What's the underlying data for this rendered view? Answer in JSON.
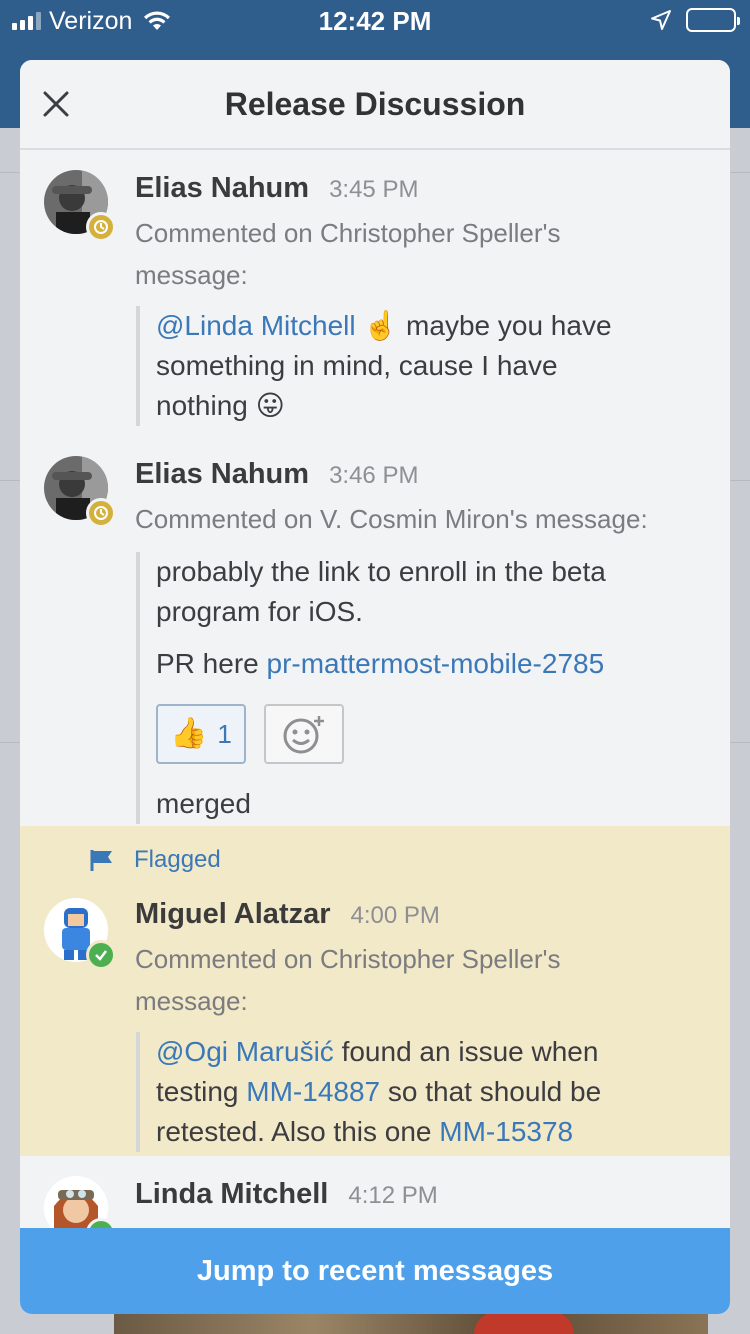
{
  "status_bar": {
    "carrier": "Verizon",
    "time": "12:42 PM"
  },
  "modal": {
    "title": "Release Discussion",
    "jump_label": "Jump to recent messages"
  },
  "posts": [
    {
      "author": "Elias Nahum",
      "time": "3:45 PM",
      "commented_line1": "Commented on Christopher Speller's",
      "commented_line2": "message:",
      "mention": "@Linda Mitchell",
      "emoji1": "☝️",
      "text_a": " maybe you have",
      "text_b": "something in mind, cause I have",
      "text_c": "nothing ",
      "emoji2": "😛",
      "status": "away"
    },
    {
      "author": "Elias Nahum",
      "time": "3:46 PM",
      "commented": "Commented on V. Cosmin Miron's message:",
      "line1": "probably the link to enroll in the beta",
      "line2": "program for iOS.",
      "pr_prefix": "PR here ",
      "pr_link": "pr-mattermost-mobile-2785",
      "reaction_emoji": "👍",
      "reaction_count": "1",
      "merged": "merged",
      "status": "away"
    },
    {
      "flag_label": "Flagged",
      "author": "Miguel Alatzar",
      "time": "4:00 PM",
      "commented_line1": "Commented on Christopher Speller's",
      "commented_line2": "message:",
      "mention": "@Ogi Marušić",
      "text_a": " found an issue when",
      "text_b1": "testing ",
      "link1": "MM-14887",
      "text_b2": " so that should be",
      "text_c1": "retested. Also this one ",
      "link2": "MM-15378",
      "status": "online"
    },
    {
      "author": "Linda Mitchell",
      "time": "4:12 PM",
      "status": "online"
    }
  ],
  "colors": {
    "header_blue": "#2f5d8c",
    "link": "#3a78b8",
    "flagged_bg": "#f1e9c8",
    "jump_bar": "#4ea0ea",
    "away": "#d4b13c",
    "online": "#4caf50"
  }
}
